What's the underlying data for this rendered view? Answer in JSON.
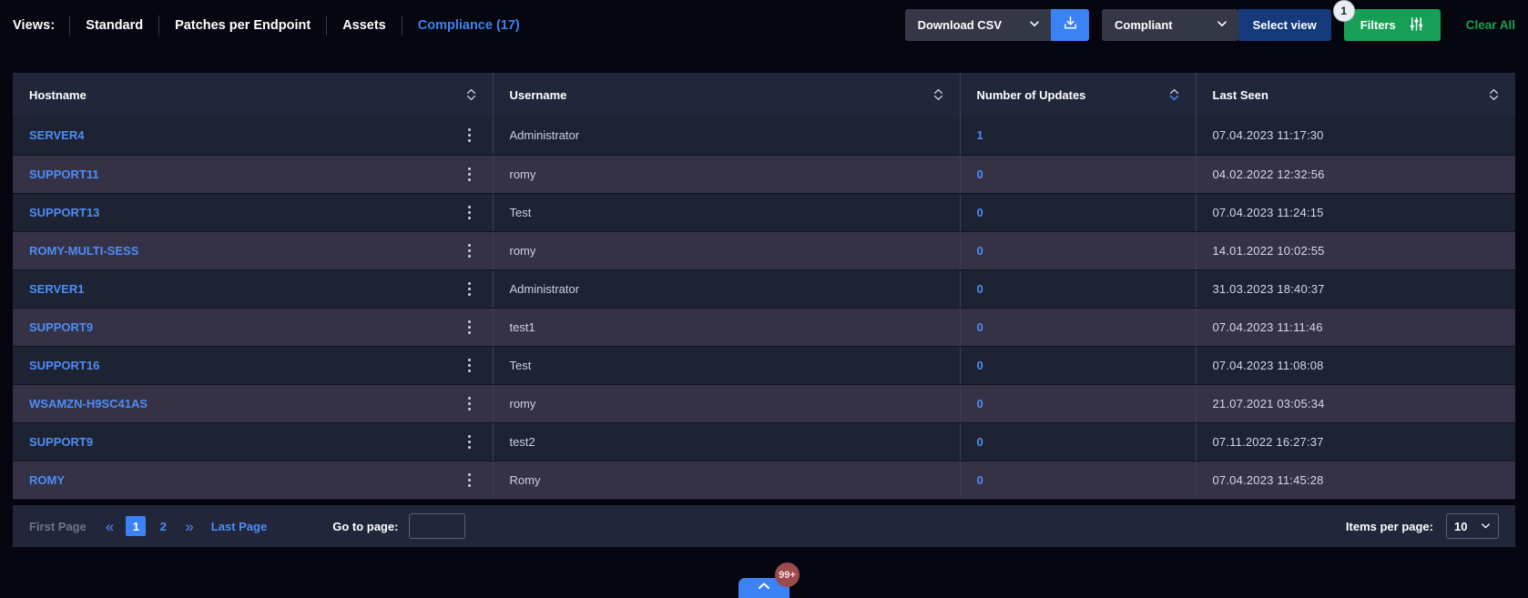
{
  "views": {
    "label": "Views:",
    "tabs": [
      {
        "label": "Standard",
        "active": false
      },
      {
        "label": "Patches per Endpoint",
        "active": false
      },
      {
        "label": "Assets",
        "active": false
      },
      {
        "label": "Compliance (17)",
        "active": true
      }
    ]
  },
  "toolbar": {
    "download_label": "Download CSV",
    "download_icon": "download-tray-icon",
    "chevron_icon": "chevron-down-icon",
    "compliance_filter_value": "Compliant",
    "select_view_label": "Select view",
    "filters_label": "Filters",
    "filters_icon": "sliders-icon",
    "filters_badge": "1",
    "clear_all_label": "Clear All",
    "accent_blue": "#3b82f6",
    "accent_green": "#17a055",
    "navy_blue": "#143a7b"
  },
  "table": {
    "columns": [
      {
        "key": "hostname",
        "label": "Hostname",
        "sort": "none"
      },
      {
        "key": "username",
        "label": "Username",
        "sort": "none"
      },
      {
        "key": "updates",
        "label": "Number of Updates",
        "sort": "desc"
      },
      {
        "key": "last_seen",
        "label": "Last Seen",
        "sort": "none"
      }
    ],
    "rows": [
      {
        "hostname": "SERVER4",
        "username": "Administrator",
        "updates": "1",
        "last_seen": "07.04.2023  11:17:30"
      },
      {
        "hostname": "SUPPORT11",
        "username": "romy",
        "updates": "0",
        "last_seen": "04.02.2022  12:32:56"
      },
      {
        "hostname": "SUPPORT13",
        "username": "Test",
        "updates": "0",
        "last_seen": "07.04.2023  11:24:15"
      },
      {
        "hostname": "ROMY-MULTI-SESS",
        "username": "romy",
        "updates": "0",
        "last_seen": "14.01.2022  10:02:55"
      },
      {
        "hostname": "SERVER1",
        "username": "Administrator",
        "updates": "0",
        "last_seen": "31.03.2023  18:40:37"
      },
      {
        "hostname": "SUPPORT9",
        "username": "test1",
        "updates": "0",
        "last_seen": "07.04.2023  11:11:46"
      },
      {
        "hostname": "SUPPORT16",
        "username": "Test",
        "updates": "0",
        "last_seen": "07.04.2023  11:08:08"
      },
      {
        "hostname": "WSAMZN-H9SC41AS",
        "username": "romy",
        "updates": "0",
        "last_seen": "21.07.2021  03:05:34"
      },
      {
        "hostname": "SUPPORT9",
        "username": "test2",
        "updates": "0",
        "last_seen": "07.11.2022  16:27:37"
      },
      {
        "hostname": "ROMY",
        "username": "Romy",
        "updates": "0",
        "last_seen": "07.04.2023  11:45:28"
      }
    ],
    "row_menu_icon": "kebab-menu-icon"
  },
  "pagination": {
    "first_page_label": "First Page",
    "prev_icon": "double-chevron-left-icon",
    "pages": [
      "1",
      "2"
    ],
    "current_page": "1",
    "next_icon": "double-chevron-right-icon",
    "last_page_label": "Last Page",
    "goto_label": "Go to page:",
    "goto_value": "",
    "goto_placeholder": "",
    "items_per_page_label": "Items per page:",
    "items_per_page_value": "10"
  },
  "floating": {
    "expand_icon": "chevron-up-icon",
    "badge_count": "99+"
  }
}
